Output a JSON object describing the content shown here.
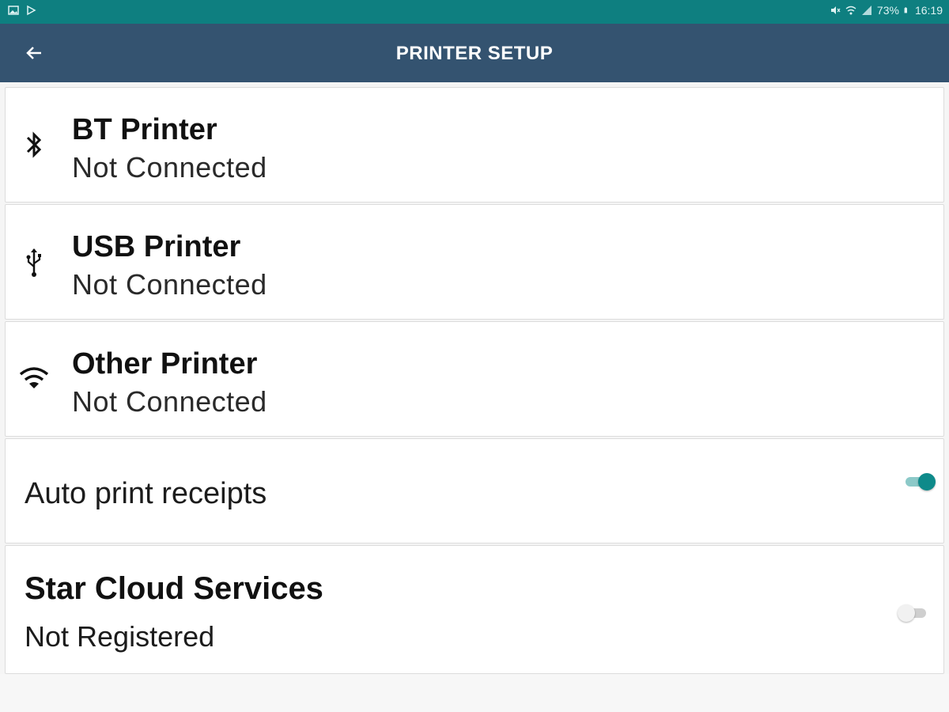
{
  "status_bar": {
    "battery": "73%",
    "time": "16:19",
    "icons": [
      "image-icon",
      "play-store-icon",
      "mute-icon",
      "wifi-icon",
      "signal-icon",
      "battery-icon"
    ]
  },
  "app_bar": {
    "title": "PRINTER SETUP",
    "back_icon": "back-arrow-icon"
  },
  "printers": [
    {
      "icon": "bluetooth-icon",
      "name": "BT Printer",
      "status": "Not Connected"
    },
    {
      "icon": "usb-icon",
      "name": "USB Printer",
      "status": "Not Connected"
    },
    {
      "icon": "wifi-icon",
      "name": "Other Printer",
      "status": "Not Connected"
    }
  ],
  "auto_print": {
    "label": "Auto print receipts",
    "enabled": true
  },
  "star_cloud": {
    "title": "Star Cloud Services",
    "status": "Not Registered",
    "enabled": false
  },
  "colors": {
    "status_bar": "#0e7f80",
    "app_bar": "#345370",
    "accent": "#0e8a8a"
  }
}
